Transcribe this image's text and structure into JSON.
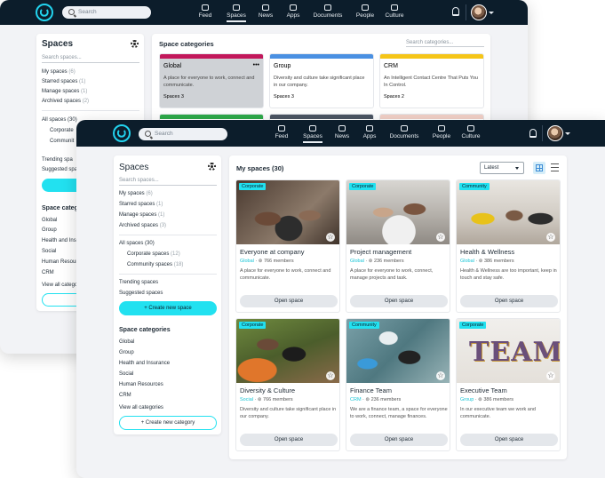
{
  "brand": {
    "accent": "#22e1f0",
    "topbar": "#0c1d2b"
  },
  "topbar": {
    "search_placeholder": "Search",
    "nav": [
      {
        "label": "Feed",
        "icon": "feed-icon"
      },
      {
        "label": "Spaces",
        "icon": "spaces-icon",
        "active": true
      },
      {
        "label": "News",
        "icon": "news-icon"
      },
      {
        "label": "Apps",
        "icon": "apps-icon"
      },
      {
        "label": "Documents",
        "icon": "documents-icon"
      },
      {
        "label": "People",
        "icon": "people-icon"
      },
      {
        "label": "Culture",
        "icon": "culture-icon"
      }
    ]
  },
  "sidebar": {
    "title": "Spaces",
    "search_placeholder": "Search spaces...",
    "links": [
      {
        "label": "My spaces",
        "count": "(6)"
      },
      {
        "label": "Starred spaces",
        "count": "(1)"
      },
      {
        "label": "Manage spaces",
        "count": "(1)"
      },
      {
        "label": "Archived spaces",
        "count": "(3)"
      }
    ],
    "all_spaces": {
      "label": "All spaces",
      "count": "(30)"
    },
    "sub_links": [
      {
        "label": "Corporate spaces",
        "count": "(12)"
      },
      {
        "label": "Community spaces",
        "count": "(18)"
      }
    ],
    "extra_links": [
      "Trending spaces",
      "Suggested spaces"
    ],
    "create_space": "+ Create new space",
    "categories_title": "Space categories",
    "categories": [
      "Global",
      "Group",
      "Health and Insurance",
      "Social",
      "Human Resources",
      "CRM"
    ],
    "view_all": "View all categories",
    "create_category": "+ Create new category"
  },
  "back_window": {
    "categories_heading": "Space categories",
    "search_placeholder": "Search categories...",
    "sidebar_counts": {
      "my": "(6)",
      "starred": "(1)",
      "manage": "(1)",
      "archived": "(2)"
    },
    "sidebar_create": "+ Cre",
    "sidebar_create_cat": "+ Crea",
    "sidebar_truncated": [
      "Corporate",
      "Communit",
      "Trending spa",
      "Suggested spa",
      "Space categ",
      "Health and Insu",
      "Human Resourc",
      "View all catego"
    ],
    "cards": [
      {
        "name": "Global",
        "desc": "A place for everyone to work, connect and communicate.",
        "spaces": "Spaces 3",
        "band": "#c2185b",
        "more": "•••"
      },
      {
        "name": "Group",
        "desc": "Diversity and culture take significant place in our company.",
        "spaces": "Spaces 3",
        "band": "#4a90e2"
      },
      {
        "name": "CRM",
        "desc": "An Intelligent Contact Centre That Puts You In Control.",
        "spaces": "Spaces 2",
        "band": "#f5c518"
      }
    ],
    "lower_bands": [
      "#2eaa4a",
      "#4b5563",
      "#f3d1c8"
    ]
  },
  "main": {
    "heading": "My spaces (30)",
    "sort": "Latest",
    "cards": [
      {
        "tag": "Corporate",
        "title": "Everyone at company",
        "category": "Global",
        "members": "766 members",
        "desc": "A place for everyone to work, connect and communicate.",
        "button": "Open space"
      },
      {
        "tag": "Corporate",
        "title": "Project management",
        "category": "Global",
        "members": "236 members",
        "desc": "A place for everyone to work, connect, manage projects and task.",
        "button": "Open space"
      },
      {
        "tag": "Community",
        "title": "Health & Wellness",
        "category": "Global",
        "members": "386 members",
        "desc": "Health & Wellness are too important, keep in touch and stay safe.",
        "button": "Open space"
      },
      {
        "tag": "Corporate",
        "title": "Diversity & Culture",
        "category": "Social",
        "members": "766 members",
        "desc": "Diversity and culture take significant place in our company.",
        "button": "Open space"
      },
      {
        "tag": "Community",
        "title": "Finance Team",
        "category": "CRM",
        "members": "236 members",
        "desc": "We are a finance team, a space for everyone to work, connect, manage finances.",
        "button": "Open space"
      },
      {
        "tag": "Corporate",
        "title": "Executive Team",
        "category": "Group",
        "members": "386 members",
        "desc": "In our executive team we work and communicate.",
        "button": "Open space"
      }
    ],
    "team_letters": "TEAM"
  }
}
